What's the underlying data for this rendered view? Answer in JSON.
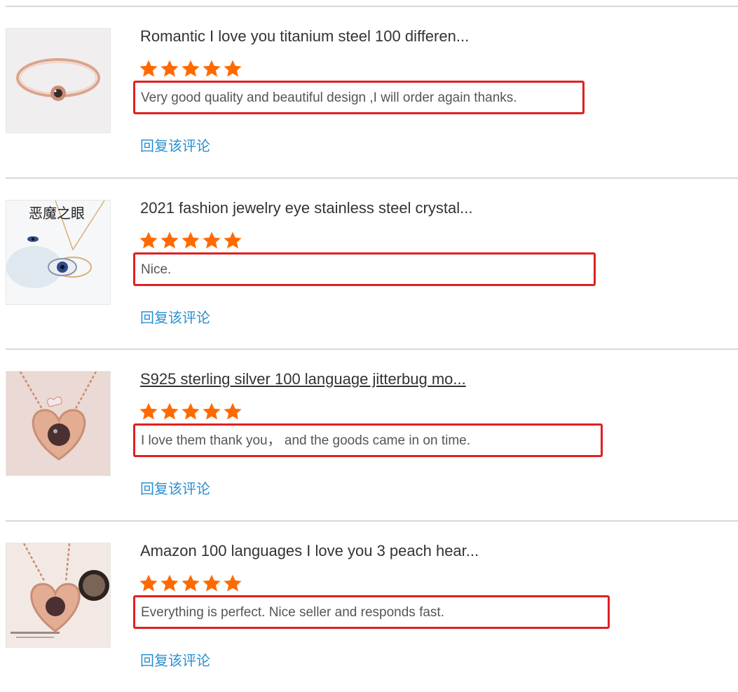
{
  "colors": {
    "star": "#ff6a00",
    "highlight_box": "#e02020",
    "reply_link": "#2a8fd0"
  },
  "reviews": [
    {
      "title": "Romantic I love you titanium steel 100 differen...",
      "rating": 5,
      "comment": "Very good quality and beautiful design ,I will order again thanks.",
      "reply_label": "回复该评论",
      "thumb_icon": "bangle-bracelet-image"
    },
    {
      "title": "2021 fashion jewelry eye stainless steel crystal...",
      "rating": 5,
      "comment": "Nice.",
      "reply_label": "回复该评论",
      "thumb_icon": "evil-eye-necklace-image",
      "thumb_text": "恶魔之眼"
    },
    {
      "title": "S925 sterling silver 100 language jitterbug mo...",
      "rating": 5,
      "comment": "I love them thank you， and the goods came in on time.",
      "reply_label": "回复该评论",
      "thumb_icon": "heart-pendant-image"
    },
    {
      "title": "Amazon 100 languages I love you 3 peach hear...",
      "rating": 5,
      "comment": "Everything is perfect. Nice seller and responds fast.",
      "reply_label": "回复该评论",
      "thumb_icon": "heart-necklace-projection-image"
    }
  ]
}
